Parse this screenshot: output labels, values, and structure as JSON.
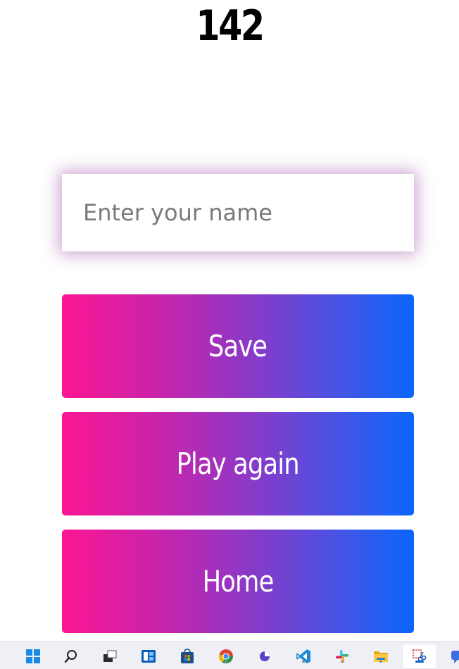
{
  "score": "142",
  "name_input": {
    "placeholder": "Enter your name",
    "value": ""
  },
  "buttons": {
    "save": "Save",
    "play_again": "Play again",
    "home": "Home"
  },
  "colors": {
    "gradient_start": "#fb1693",
    "gradient_end": "#0a66fc",
    "input_glow": "#8c3296"
  },
  "taskbar": {
    "icons": [
      "windows-start-icon",
      "search-icon",
      "task-view-icon",
      "widgets-icon",
      "store-icon",
      "chrome-icon",
      "app-icon",
      "vscode-icon",
      "slack-icon",
      "file-explorer-icon",
      "snipping-tool-icon",
      "chat-icon"
    ]
  }
}
